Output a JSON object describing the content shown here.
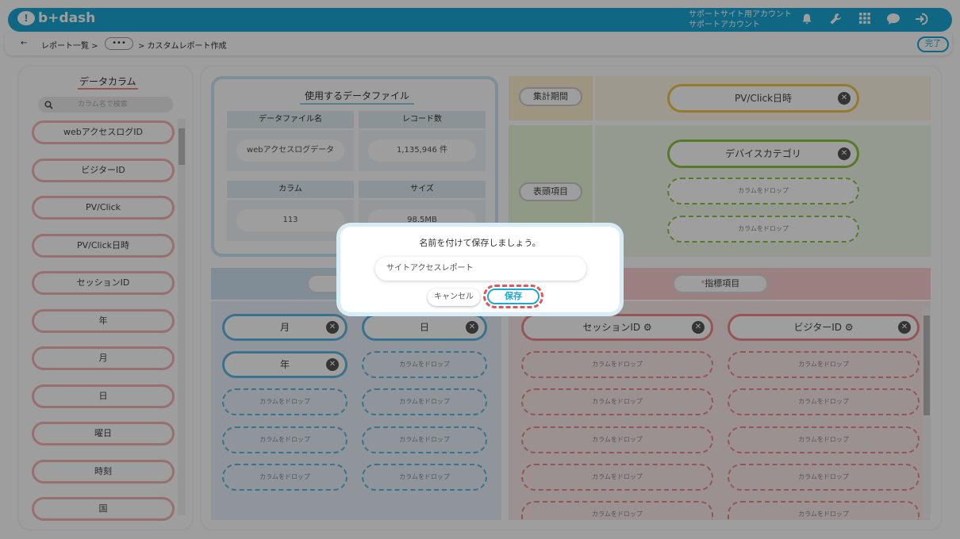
{
  "app": {
    "logo_text": "b+dash",
    "logo_mark": "!"
  },
  "account": {
    "line1": "サポートサイト用アカウント",
    "line2": "サポートアカウント"
  },
  "toolbar_icons": [
    "bell-icon",
    "wrench-icon",
    "grid-icon",
    "chat-icon",
    "logout-icon"
  ],
  "breadcrumb": {
    "back": "←",
    "item1": "レポート一覧 >",
    "ellipsis": "•••",
    "item2": "> カスタムレポート作成",
    "done": "完了"
  },
  "sidebar": {
    "title": "データカラム",
    "search_placeholder": "カラム名で検索",
    "columns": [
      "webアクセスログID",
      "ビジターID",
      "PV/Click",
      "PV/Click日時",
      "セッションID",
      "年",
      "月",
      "日",
      "曜日",
      "時刻",
      "国"
    ]
  },
  "datafile": {
    "title": "使用するデータファイル",
    "h_name": "データファイル名",
    "h_records": "レコード数",
    "v_name": "webアクセスログデータ",
    "v_records": "1,135,946 件",
    "h_columns": "カラム",
    "h_size": "サイズ",
    "v_columns": "113",
    "v_size": "98.5MB"
  },
  "period": {
    "label": "集計期間",
    "chip": "PV/Click日時"
  },
  "header_items": {
    "label": "表頭項目",
    "chip": "デバイスカテゴリ",
    "drop": "カラムをドロップ"
  },
  "row_items": {
    "chips": [
      "月",
      "日",
      "年"
    ],
    "drop": "カラムをドロップ"
  },
  "metrics": {
    "label": "指標項目",
    "required_mark": "*",
    "chips": [
      "セッションID",
      "ビジターID"
    ],
    "drop": "カラムをドロップ"
  },
  "modal": {
    "title": "名前を付けて保存しましょう。",
    "input_value": "サイトアクセスレポート",
    "cancel": "キャンセル",
    "save": "保存"
  },
  "colors": {
    "brand": "#1ba7d6",
    "highlight": "#e0575b"
  }
}
